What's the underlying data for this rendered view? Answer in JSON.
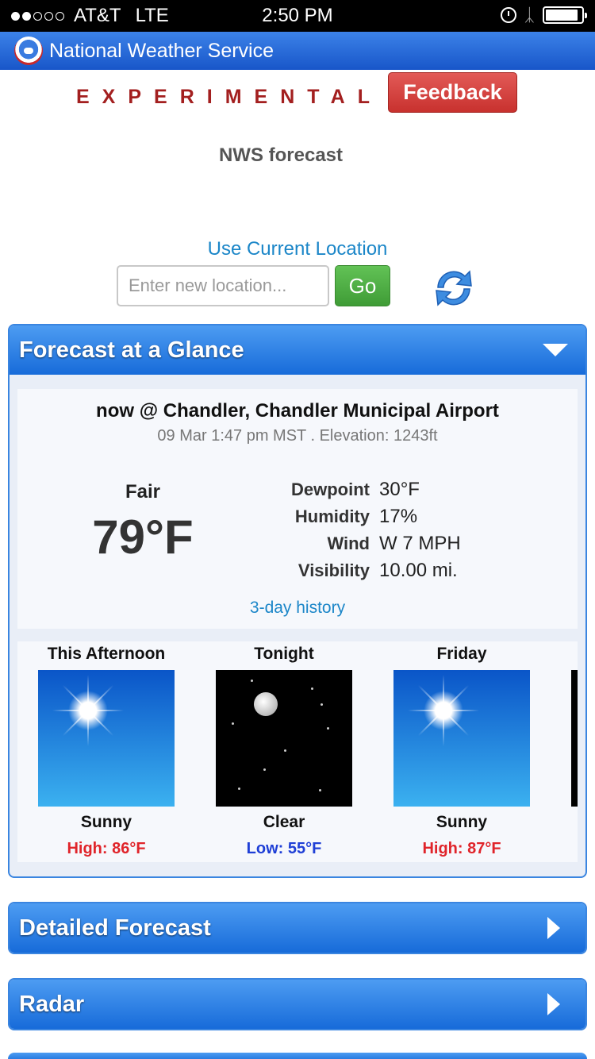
{
  "status_bar": {
    "carrier": "AT&T",
    "network": "LTE",
    "time": "2:50 PM"
  },
  "nav": {
    "title": "National Weather Service"
  },
  "banner": {
    "experimental": "EXPERIMENTAL",
    "feedback_label": "Feedback",
    "subtitle": "NWS forecast"
  },
  "location": {
    "use_current": "Use Current Location",
    "placeholder": "Enter new location...",
    "go_label": "Go"
  },
  "glance": {
    "title": "Forecast at a Glance",
    "current": {
      "heading": "now @ Chandler, Chandler Municipal Airport",
      "meta": "09 Mar 1:47 pm MST . Elevation: 1243ft",
      "condition": "Fair",
      "temperature": "79°F",
      "observations": [
        {
          "label": "Dewpoint",
          "value": "30°F"
        },
        {
          "label": "Humidity",
          "value": "17%"
        },
        {
          "label": "Wind",
          "value": "W 7 MPH"
        },
        {
          "label": "Visibility",
          "value": "10.00 mi."
        }
      ],
      "history_link": "3-day history"
    },
    "periods": [
      {
        "name": "This Afternoon",
        "short": "Sunny",
        "temp": "High: 86°F",
        "icon": "sunny-icon"
      },
      {
        "name": "Tonight",
        "short": "Clear",
        "temp": "Low: 55°F",
        "icon": "clear-night-icon"
      },
      {
        "name": "Friday",
        "short": "Sunny",
        "temp": "High: 87°F",
        "icon": "sunny-icon"
      }
    ]
  },
  "sections": {
    "detailed": "Detailed Forecast",
    "radar": "Radar"
  },
  "colors": {
    "accent_blue": "#1b6fd9",
    "high_temp": "#e0242a",
    "low_temp": "#1f3fd6",
    "feedback_red": "#c8312e",
    "go_green": "#3f9c36"
  }
}
